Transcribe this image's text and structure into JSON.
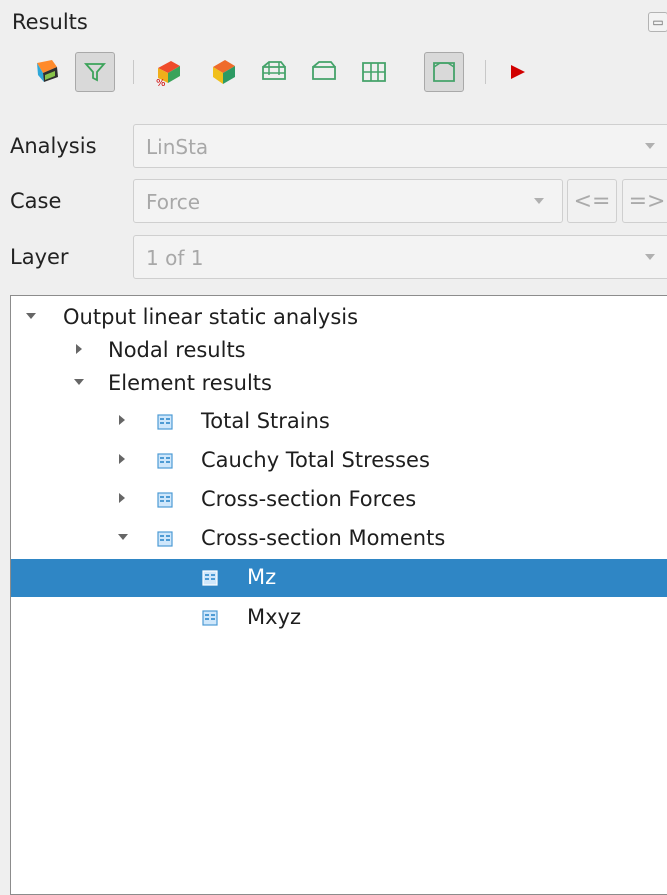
{
  "panel": {
    "title": "Results",
    "close_icon": "float-close-icon"
  },
  "toolbar": {
    "buttons": [
      {
        "icon": "color-model-icon",
        "active": false
      },
      {
        "icon": "filter-icon",
        "active": true
      },
      {
        "icon": "percentage-result-icon",
        "active": false
      },
      {
        "icon": "deformed-shape-icon",
        "active": false
      },
      {
        "icon": "element-edges-icon",
        "active": false
      },
      {
        "icon": "element-outline-icon",
        "active": false
      },
      {
        "icon": "element-grid-icon",
        "active": false
      },
      {
        "icon": "element-border-icon",
        "active": true
      },
      {
        "icon": "play-icon",
        "active": false
      }
    ],
    "accent_play": "#d10000"
  },
  "form": {
    "analysis": {
      "label": "Analysis",
      "value": "LinSta"
    },
    "case": {
      "label": "Case",
      "value": "Force",
      "prev_label": "<=",
      "next_label": "=>"
    },
    "layer": {
      "label": "Layer",
      "value": "1 of 1"
    }
  },
  "tree": {
    "root": "Output linear static analysis",
    "nodal": "Nodal results",
    "element": "Element results",
    "items": [
      "Total Strains",
      "Cauchy Total Stresses",
      "Cross-section Forces",
      "Cross-section Moments"
    ],
    "children": [
      "Mz",
      "Mxyz"
    ],
    "selected": "Mz",
    "selection_color": "#2f86c5"
  }
}
